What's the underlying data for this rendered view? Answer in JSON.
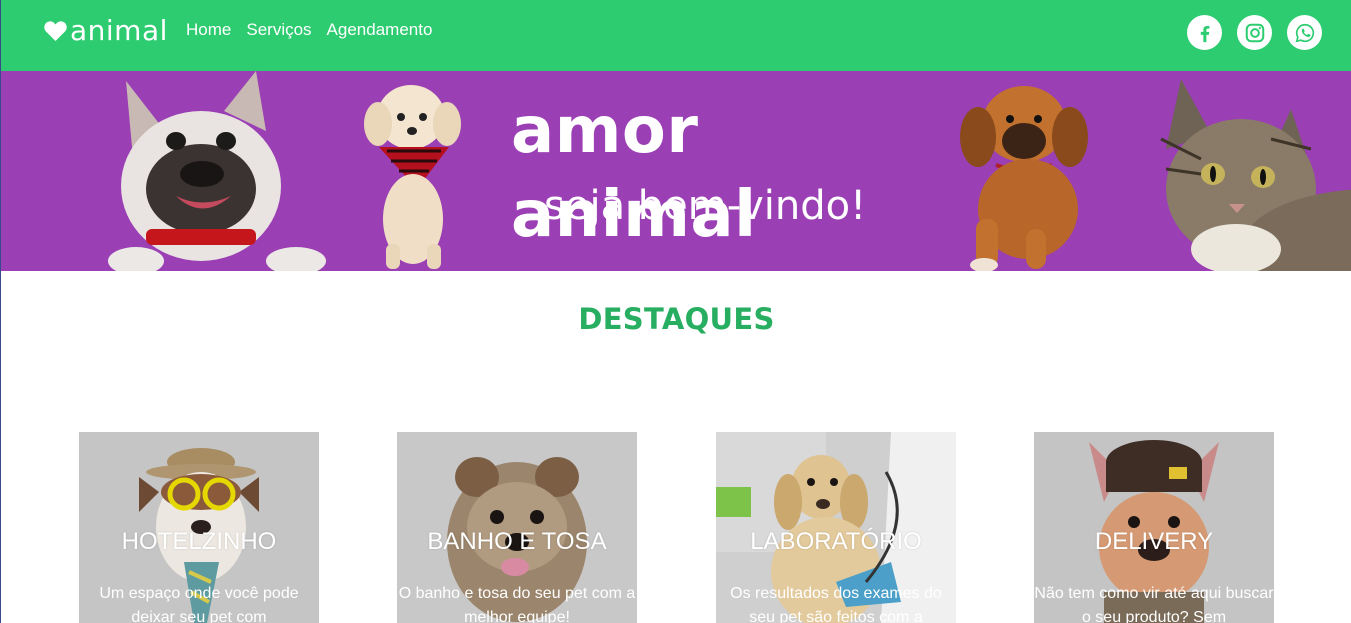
{
  "navbar": {
    "brand": "animal",
    "links": [
      "Home",
      "Serviços",
      "Agendamento"
    ],
    "social_icons": [
      "facebook-icon",
      "instagram-icon",
      "whatsapp-icon"
    ],
    "color": "#2ecc71"
  },
  "hero": {
    "title": "amor animal",
    "subtitle": "seja bem-vindo!",
    "background": "#9b3fb5"
  },
  "highlights": {
    "title": "DESTAQUES",
    "title_color": "#27ae60",
    "cards": [
      {
        "title": "HOTELZINHO",
        "text": "Um espaço onde você pode deixar seu pet com"
      },
      {
        "title": "BANHO E TOSA",
        "text": "O banho e tosa do seu pet com a melhor equipe!"
      },
      {
        "title": "LABORATÓRIO",
        "text": "Os resultados dos exames do seu pet são feitos com a"
      },
      {
        "title": "DELIVERY",
        "text": "Não tem como vir até aqui buscar o seu produto? Sem"
      }
    ]
  }
}
